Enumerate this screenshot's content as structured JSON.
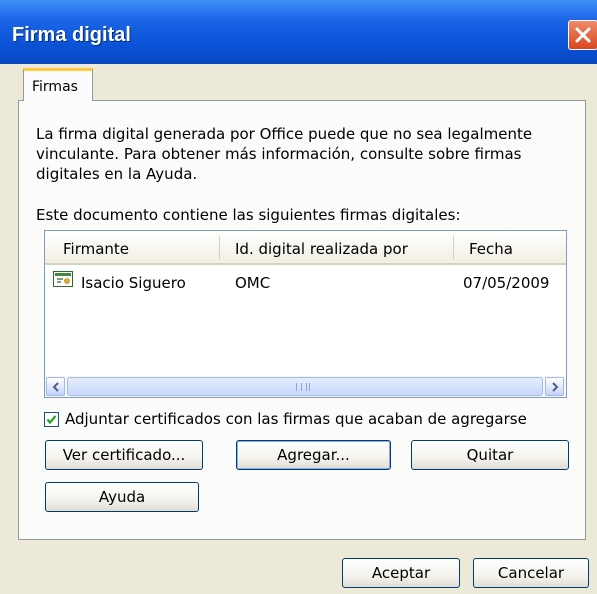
{
  "window": {
    "title": "Firma digital"
  },
  "tabs": [
    {
      "label": "Firmas"
    }
  ],
  "description": "La firma digital generada por Office puede que no sea legalmente vinculante. Para obtener más información, consulte sobre firmas digitales en la Ayuda.",
  "list_label": "Este documento contiene las siguientes firmas digitales:",
  "signatures": {
    "columns": [
      "Firmante",
      "Id. digital realizada por",
      "Fecha"
    ],
    "rows": [
      {
        "signer": "Isacio Siguero",
        "issued_by": "OMC",
        "date": "07/05/2009",
        "icon": "certificate-icon"
      }
    ]
  },
  "attach_certificates": {
    "label": "Adjuntar certificados con las firmas que acaban de agregarse",
    "checked": true
  },
  "buttons": {
    "view_certificate": "Ver certificado...",
    "add": "Agregar...",
    "remove": "Quitar",
    "help": "Ayuda",
    "ok": "Aceptar",
    "cancel": "Cancelar"
  },
  "colors": {
    "titlebar": "#0a52d6",
    "close_button": "#d9461e",
    "tab_highlight": "#ffc83c",
    "dialog_bg": "#ece9d8"
  }
}
